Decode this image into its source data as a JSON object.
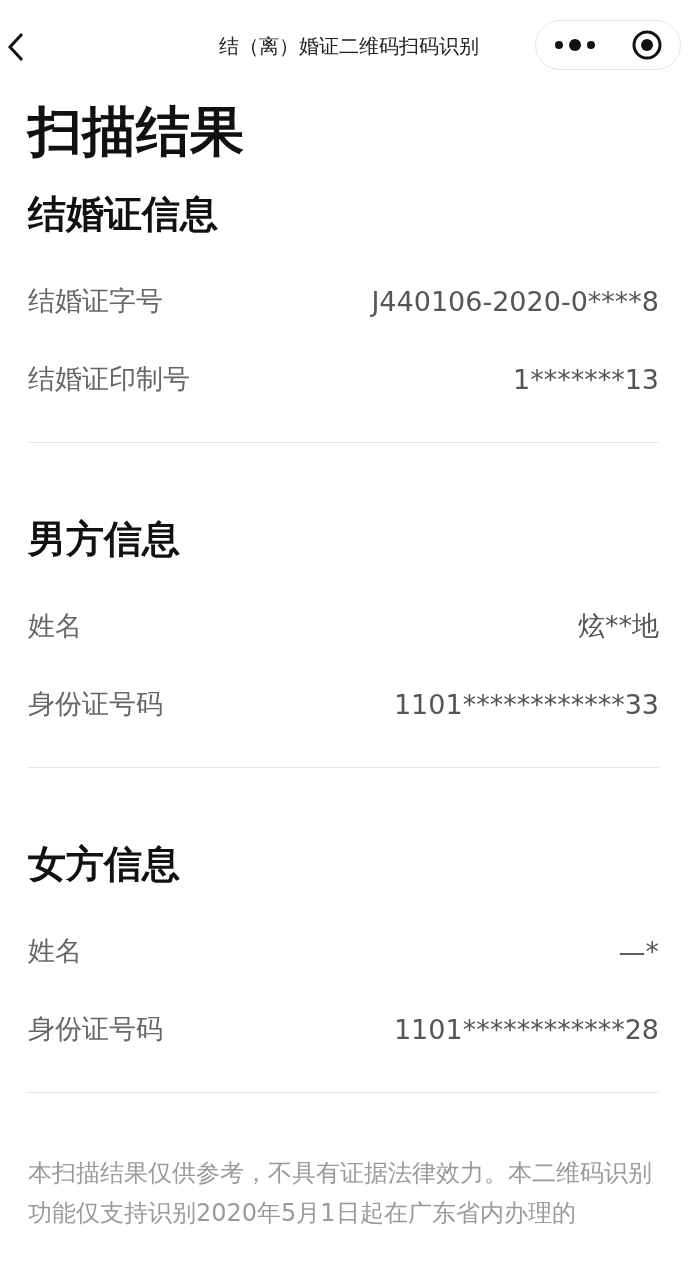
{
  "nav_bar": {
    "title": "结（离）婚证二维码扫码识别"
  },
  "page_title": "扫描结果",
  "sections": [
    {
      "heading": "结婚证信息",
      "rows": [
        {
          "label": "结婚证字号",
          "value": "J440106-2020-0****8"
        },
        {
          "label": "结婚证印制号",
          "value": "1*******13"
        }
      ]
    },
    {
      "heading": "男方信息",
      "rows": [
        {
          "label": "姓名",
          "value": "炫**地"
        },
        {
          "label": "身份证号码",
          "value": "1101************33"
        }
      ]
    },
    {
      "heading": "女方信息",
      "rows": [
        {
          "label": "姓名",
          "value": "—*"
        },
        {
          "label": "身份证号码",
          "value": "1101************28"
        }
      ]
    }
  ],
  "footer_note": "本扫描结果仅供参考，不具有证据法律效力。本二维码识别功能仅支持识别2020年5月1日起在广东省内办理的"
}
